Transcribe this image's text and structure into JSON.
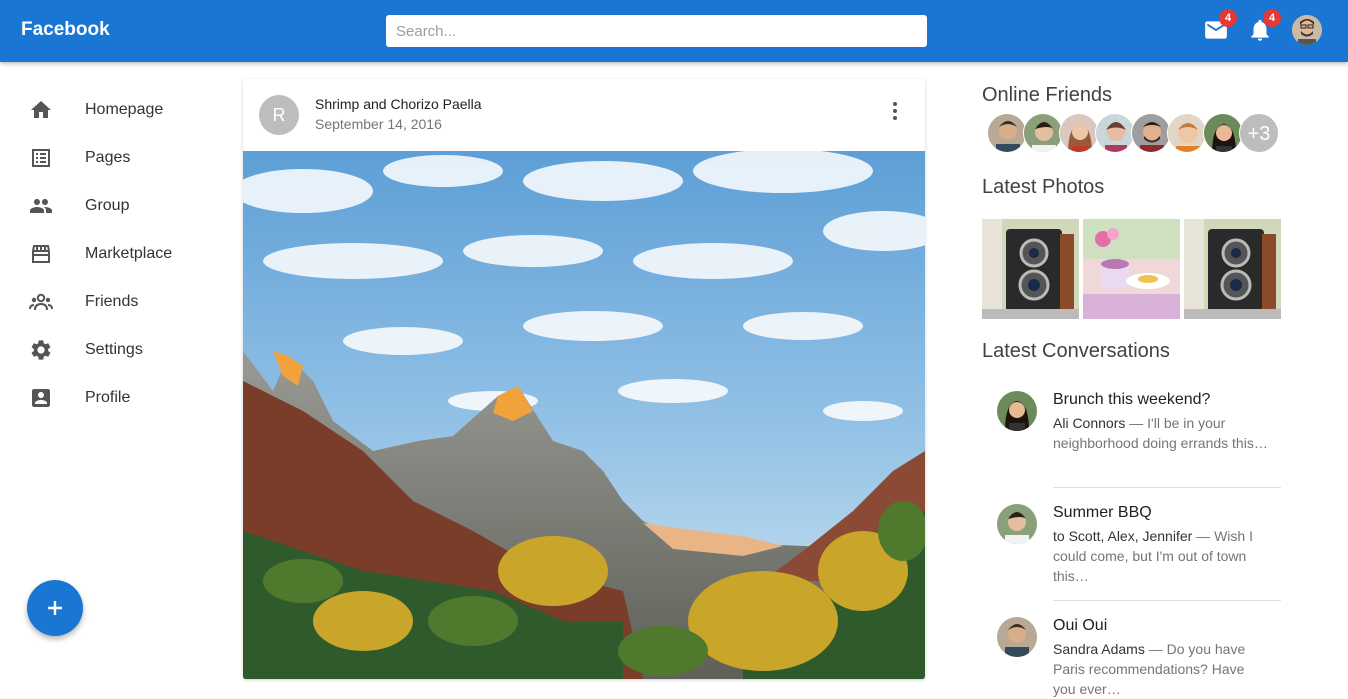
{
  "header": {
    "brand": "Facebook",
    "search_placeholder": "Search...",
    "mail_badge": "4",
    "notifications_badge": "4",
    "accent_color": "#1976d2",
    "badge_color": "#e53935"
  },
  "nav": {
    "items": [
      {
        "label": "Homepage",
        "icon": "home-icon"
      },
      {
        "label": "Pages",
        "icon": "pages-icon"
      },
      {
        "label": "Group",
        "icon": "group-icon"
      },
      {
        "label": "Marketplace",
        "icon": "store-icon"
      },
      {
        "label": "Friends",
        "icon": "friends-icon"
      },
      {
        "label": "Settings",
        "icon": "settings-icon"
      },
      {
        "label": "Profile",
        "icon": "profile-icon"
      }
    ]
  },
  "fab": {
    "icon": "plus-icon"
  },
  "post": {
    "avatar_letter": "R",
    "title": "Shrimp and Chorizo Paella",
    "date": "September 14, 2016"
  },
  "sidebar": {
    "online_heading": "Online Friends",
    "more_friends": "+3",
    "photos_heading": "Latest Photos",
    "conversations_heading": "Latest Conversations",
    "conversations": [
      {
        "title": "Brunch this weekend?",
        "who": "Ali Connors",
        "text": " — I'll be in your neighborhood doing errands this…"
      },
      {
        "title": "Summer BBQ",
        "who": "to Scott, Alex, Jennifer",
        "text": " — Wish I could come, but I'm out of town this…"
      },
      {
        "title": "Oui Oui",
        "who": "Sandra Adams",
        "text": " — Do you have Paris recommendations? Have you ever…"
      }
    ]
  }
}
